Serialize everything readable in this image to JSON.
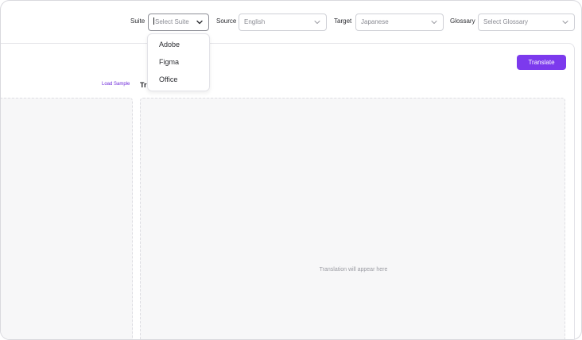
{
  "toolbar": {
    "suite": {
      "label": "Suite",
      "placeholder": "Select Suite"
    },
    "source": {
      "label": "Source",
      "value": "English"
    },
    "target": {
      "label": "Target",
      "value": "Japanese"
    },
    "glossary": {
      "label": "Glossary",
      "placeholder": "Select Glossary"
    }
  },
  "suite_menu": {
    "items": [
      "Adobe",
      "Figma",
      "Office"
    ]
  },
  "main": {
    "translate_label": "Translate",
    "load_sample_label": "Load Sample",
    "output_title": "Tr",
    "output_placeholder": "Translation will appear here"
  },
  "colors": {
    "accent": "#7c3aed",
    "link": "#6d28d9",
    "panel_bg": "#f7f7f8"
  },
  "icons": {
    "caret": "chevron-down-icon"
  }
}
